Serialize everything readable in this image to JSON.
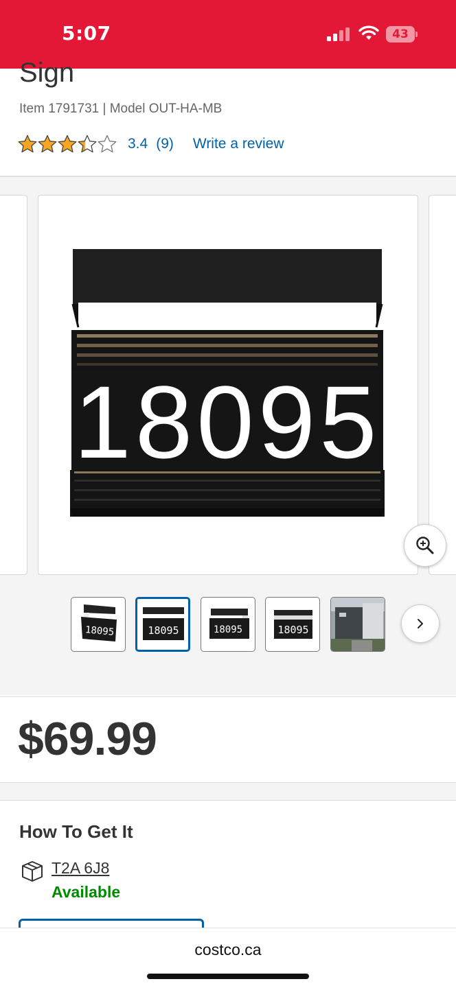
{
  "status_bar": {
    "time": "5:07",
    "battery": "43",
    "background_color": "#e31837"
  },
  "product": {
    "title_partial": "Sign",
    "item_model": "Item 1791731 | Model OUT-HA-MB",
    "rating": {
      "stars_value": 3.4,
      "value": "3.4",
      "count": "(9)",
      "write_review": "Write a review"
    },
    "image_number": "18095",
    "price": "$69.99"
  },
  "gallery": {
    "thumbnails": [
      {
        "label": "18095",
        "active": false
      },
      {
        "label": "18095",
        "active": true
      },
      {
        "label": "18095",
        "active": false
      },
      {
        "label": "18095",
        "active": false
      },
      {
        "label": "",
        "active": false
      }
    ]
  },
  "fulfillment": {
    "heading": "How To Get It",
    "postal_code": "T2A 6J8",
    "availability": "Available"
  },
  "browser": {
    "url": "costco.ca"
  },
  "colors": {
    "brand_red": "#e31837",
    "link_blue": "#0060a9",
    "star_gold": "#f5a623",
    "available_green": "#008a00"
  }
}
